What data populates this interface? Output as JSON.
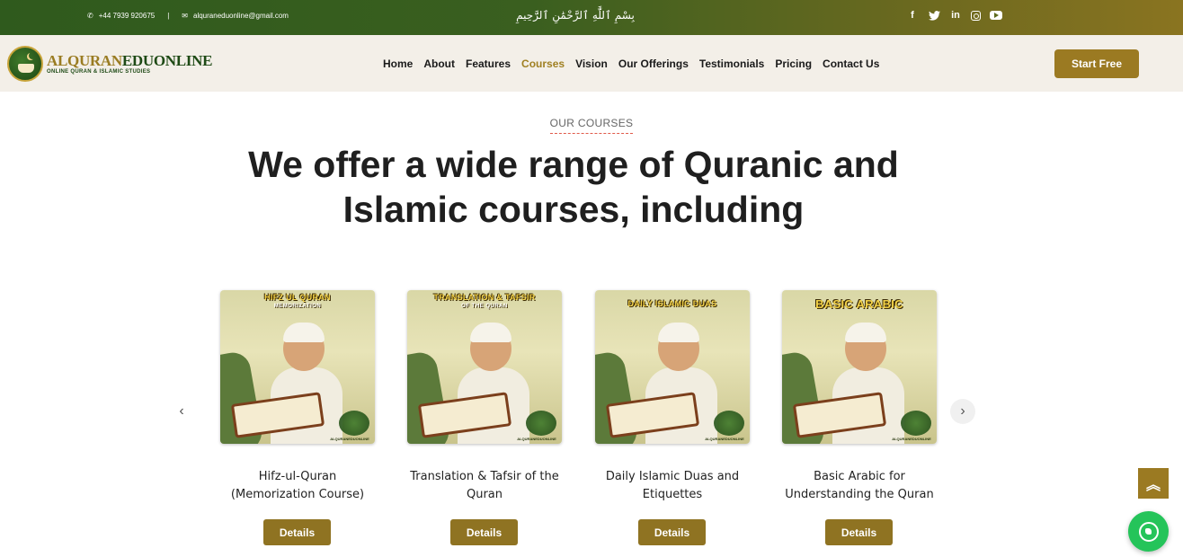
{
  "topbar": {
    "phone": "+44 7939 920675",
    "separator": "|",
    "email": "alquraneduonline@gmail.com",
    "bismillah": "بِسْمِ ٱللَّٰهِ ٱلرَّحْمَٰنِ ٱلرَّحِيمِ",
    "socials": [
      "facebook-icon",
      "twitter-icon",
      "linkedin-icon",
      "instagram-icon",
      "youtube-icon"
    ]
  },
  "header": {
    "brand_part1": "ALQURAN",
    "brand_part2": "EDUONLINE",
    "tagline": "ONLINE QURAN & ISLAMIC STUDIES",
    "nav": [
      {
        "label": "Home",
        "active": false
      },
      {
        "label": "About",
        "active": false
      },
      {
        "label": "Features",
        "active": false
      },
      {
        "label": "Courses",
        "active": true
      },
      {
        "label": "Vision",
        "active": false
      },
      {
        "label": "Our Offerings",
        "active": false
      },
      {
        "label": "Testimonials",
        "active": false
      },
      {
        "label": "Pricing",
        "active": false
      },
      {
        "label": "Contact Us",
        "active": false
      }
    ],
    "cta": "Start Free"
  },
  "section": {
    "eyebrow": "OUR COURSES",
    "headline": "We offer a wide range of Quranic and Islamic courses, including"
  },
  "courses": [
    {
      "banner": "HIFZ UL QURAN",
      "banner_sub": "MEMORIZATION",
      "title": "Hifz-ul-Quran (Memorization Course)",
      "button": "Details"
    },
    {
      "banner": "TRANSLATION & TAFSIR",
      "banner_sub": "OF THE QURAN",
      "title": "Translation & Tafsir of the Quran",
      "button": "Details"
    },
    {
      "banner": "DAILY ISLAMIC DUAS",
      "banner_sub": "",
      "title": "Daily Islamic Duas and Etiquettes",
      "button": "Details"
    },
    {
      "banner": "BASIC ARABIC",
      "banner_sub": "",
      "title": "Basic Arabic for Understanding the Quran",
      "button": "Details"
    }
  ],
  "image_watermark": "ALQURANEDUONLINE",
  "carousel": {
    "prev": "‹",
    "next": "›"
  },
  "floating": {
    "scroll_top": "︽"
  },
  "colors": {
    "accent": "#9b7a22",
    "topbar_start": "#2f5a1d",
    "topbar_end": "#8a7420",
    "header_bg": "#f3efe8",
    "whatsapp": "#25c45a"
  }
}
